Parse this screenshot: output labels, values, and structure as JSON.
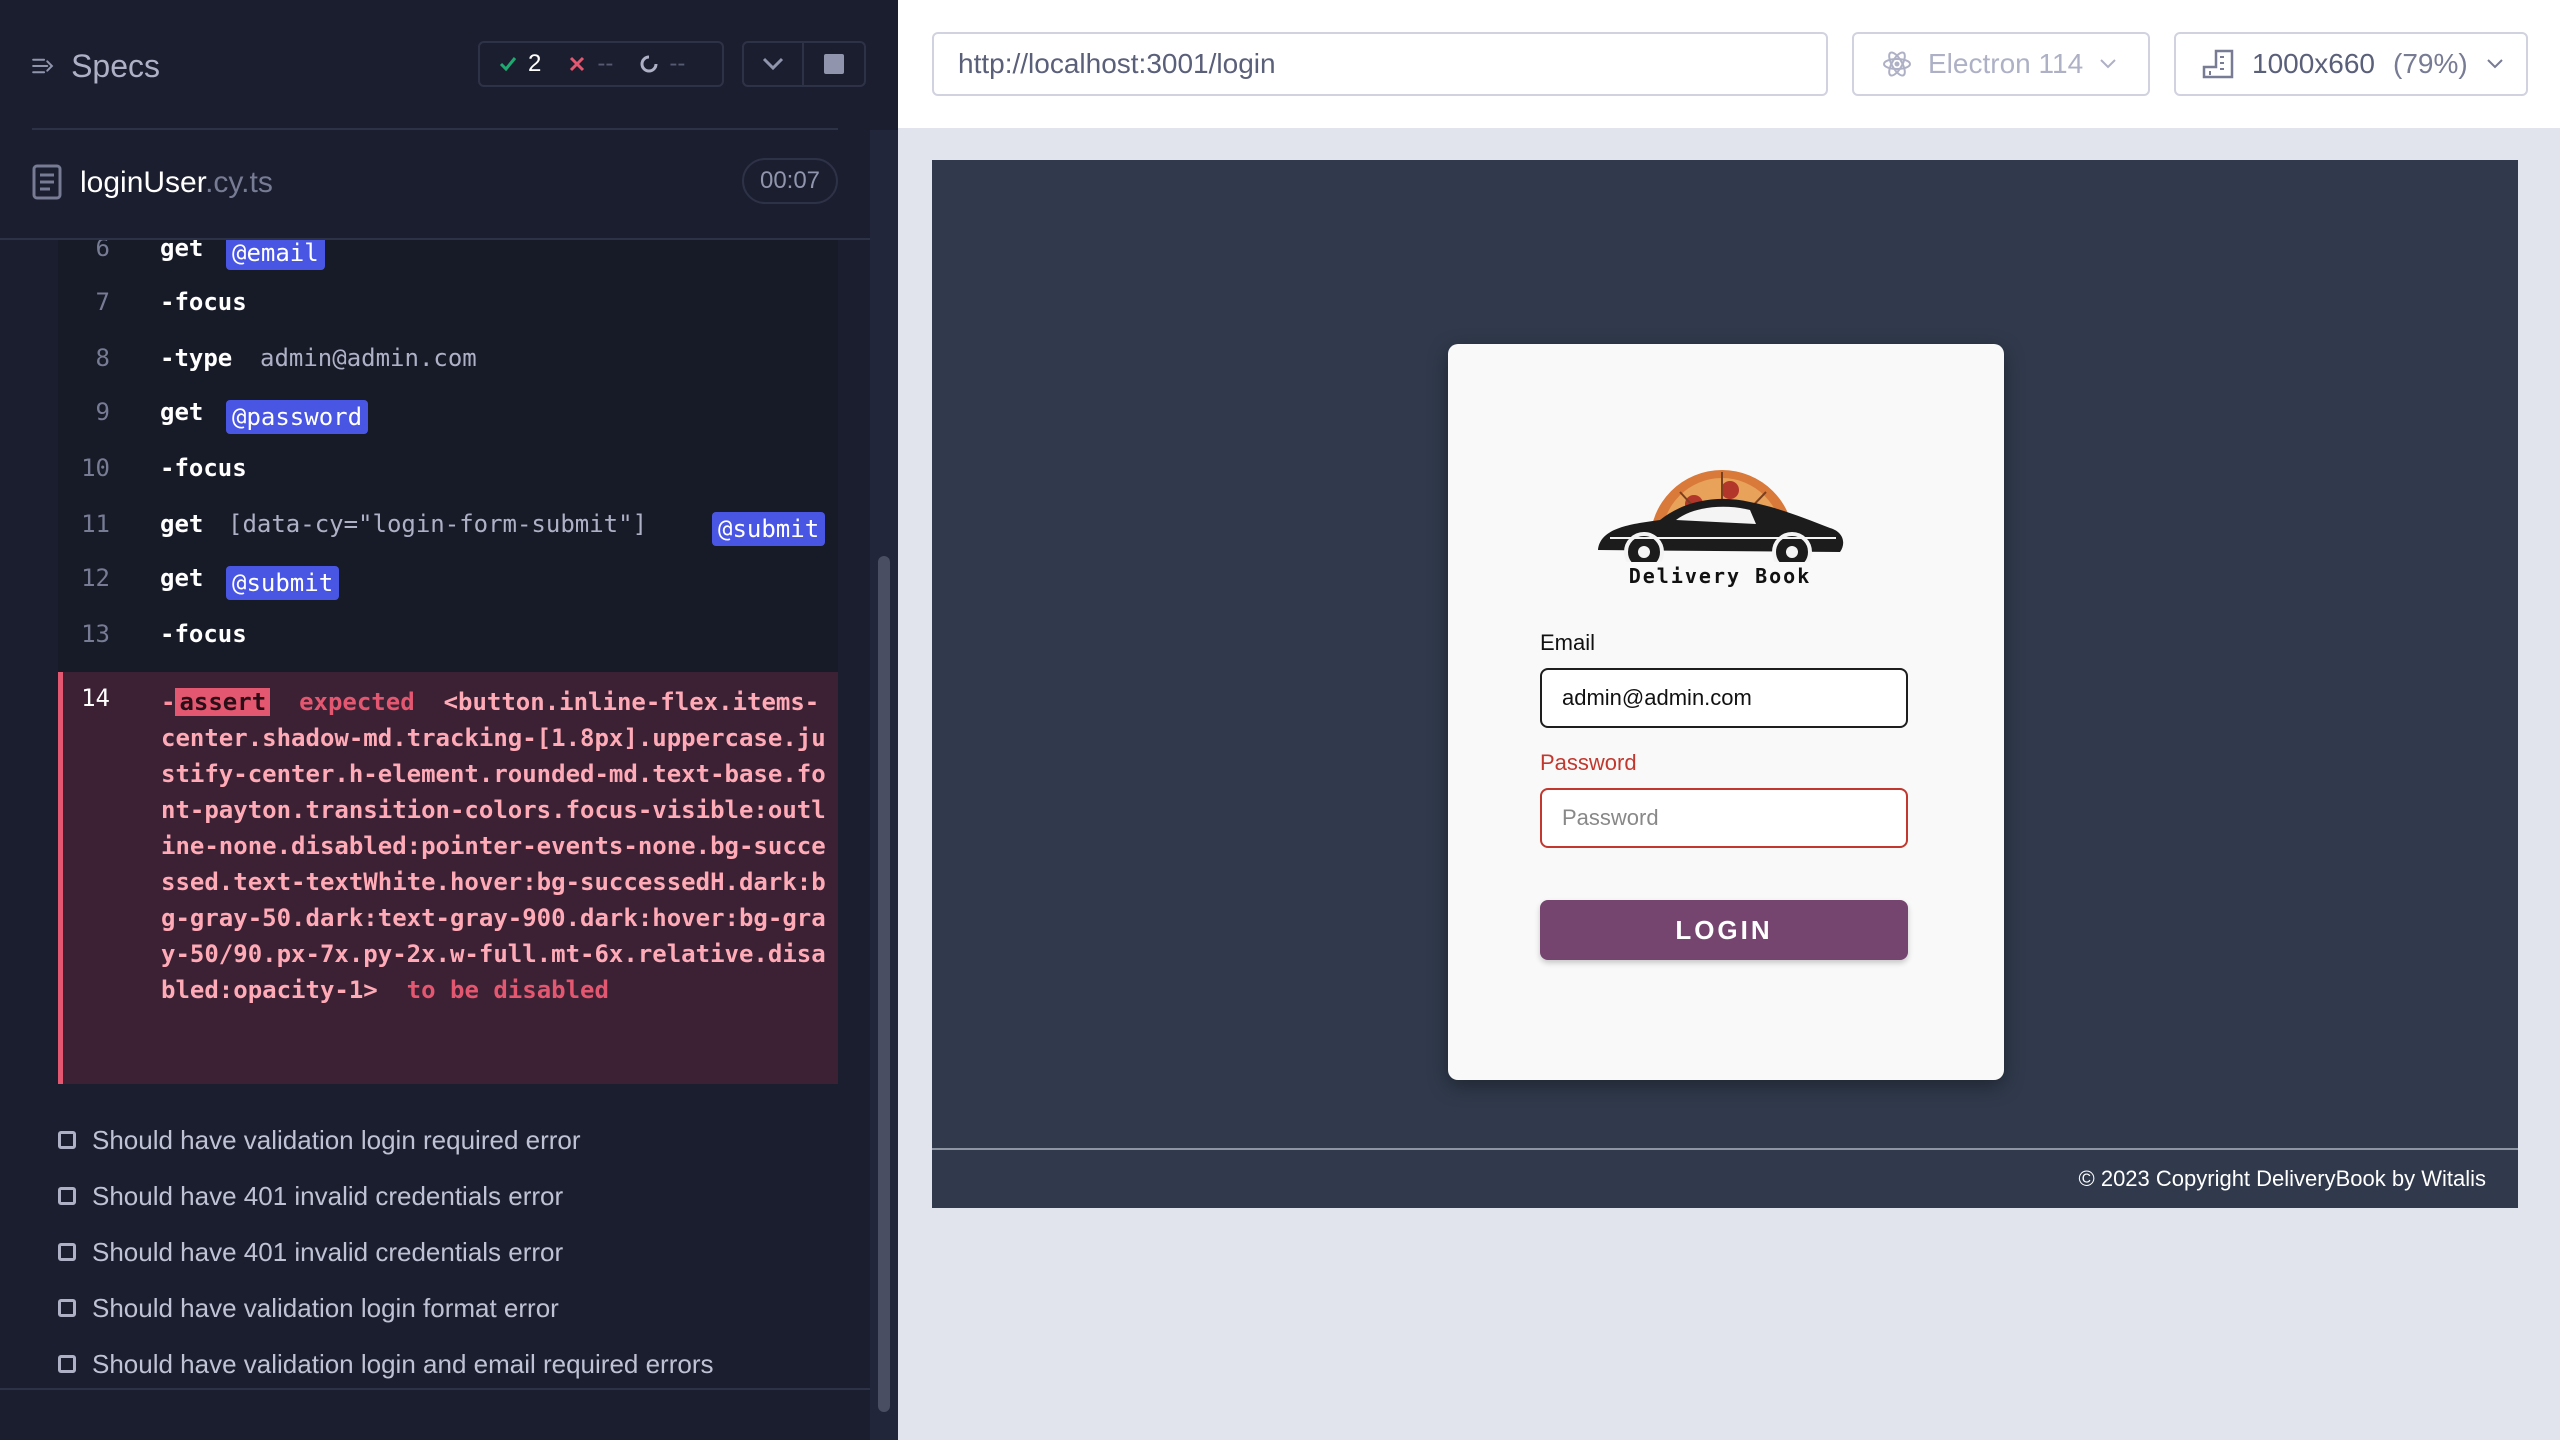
{
  "reporter": {
    "specs_label": "Specs",
    "stats": {
      "passed": "2",
      "failed": "--",
      "pending": "--"
    },
    "file": {
      "name": "loginUser",
      "ext": ".cy.ts",
      "duration": "00:07"
    },
    "commands": [
      {
        "num": "6",
        "name": "get",
        "alias": "@email"
      },
      {
        "num": "7",
        "name": "-focus"
      },
      {
        "num": "8",
        "name": "-type",
        "message": "admin@admin.com"
      },
      {
        "num": "9",
        "name": "get",
        "alias": "@password"
      },
      {
        "num": "10",
        "name": "-focus"
      },
      {
        "num": "11",
        "name": "get",
        "message": "[data-cy=\"login-form-submit\"]",
        "alias": "@submit"
      },
      {
        "num": "12",
        "name": "get",
        "alias": "@submit"
      },
      {
        "num": "13",
        "name": "-focus"
      }
    ],
    "error_command": {
      "num": "14",
      "prefix": "-",
      "name": "assert",
      "expected": "expected",
      "target": "<button.inline-flex.items-center.shadow-md.tracking-[1.8px].uppercase.justify-center.h-element.rounded-md.text-base.font-payton.transition-colors.focus-visible:outline-none.disabled:pointer-events-none.bg-successed.text-textWhite.hover:bg-successedH.dark:bg-gray-50.dark:text-gray-900.dark:hover:bg-gray-50/90.px-7x.py-2x.w-full.mt-6x.relative.disabled:opacity-1>",
      "suffix": "to be disabled"
    },
    "tests": [
      "Should have validation login required error",
      "Should have 401 invalid credentials error",
      "Should have 401 invalid credentials error",
      "Should have validation login format error",
      "Should have validation login and email required errors"
    ]
  },
  "aut": {
    "url": "http://localhost:3001/login",
    "browser": "Electron 114",
    "viewport": "1000x660",
    "scale": "(79%)",
    "app": {
      "logo_text": "Delivery Book",
      "email_label": "Email",
      "email_value": "admin@admin.com",
      "password_label": "Password",
      "password_placeholder": "Password",
      "login_label": "LOGIN",
      "footer": "© 2023 Copyright DeliveryBook by Witalis"
    }
  },
  "colors": {
    "reporter_bg": "#1b1e2e",
    "alias_bg": "#4956e3",
    "error_accent": "#e45770",
    "pass_green": "#1fa971",
    "app_bg": "#303a4c",
    "login_button": "#75446f",
    "error_red": "#c2382f"
  },
  "icons": [
    "specs-list-icon",
    "check-icon",
    "x-icon",
    "spinner-icon",
    "chevron-down-icon",
    "stop-icon",
    "file-icon",
    "electron-icon",
    "viewport-ruler-icon"
  ]
}
